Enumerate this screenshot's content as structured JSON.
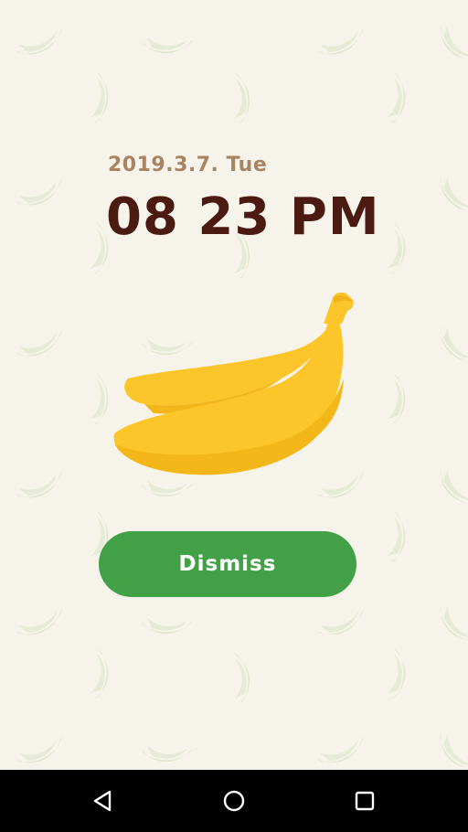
{
  "alarm": {
    "date": "2019.3.7. Tue",
    "time": "08 23 PM"
  },
  "dismiss_button": {
    "label": "Dismiss"
  },
  "navigation": {
    "back_icon": "back-triangle-icon",
    "home_icon": "home-circle-icon",
    "recents_icon": "recents-square-icon"
  },
  "colors": {
    "background": "#f6f4ea",
    "date_text": "#a88462",
    "time_text": "#4b1a10",
    "button": "#42a047",
    "banana": "#fcc62a",
    "pattern": "#d8e2c4"
  }
}
